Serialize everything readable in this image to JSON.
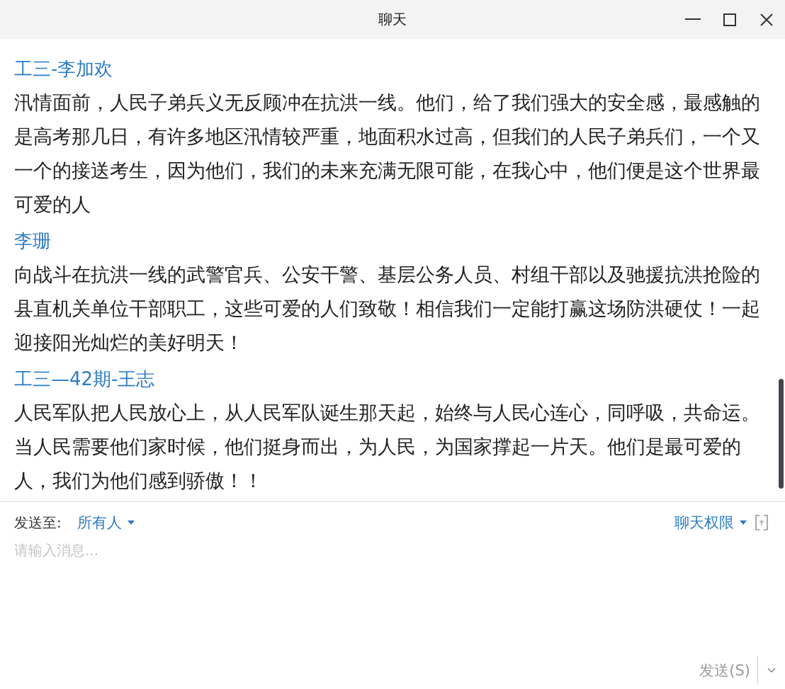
{
  "window": {
    "title": "聊天"
  },
  "messages": [
    {
      "sender": "工三-李加欢",
      "text": "汛情面前，人民子弟兵义无反顾冲在抗洪一线。他们，给了我们强大的安全感，最感触的是高考那几日，有许多地区汛情较严重，地面积水过高，但我们的人民子弟兵们，一个又一个的接送考生，因为他们，我们的未来充满无限可能，在我心中，他们便是这个世界最可爱的人"
    },
    {
      "sender": "李珊",
      "text": "向战斗在抗洪一线的武警官兵、公安干警、基层公务人员、村组干部以及驰援抗洪抢险的县直机关单位干部职工，这些可爱的人们致敬！相信我们一定能打赢这场防洪硬仗！一起迎接阳光灿烂的美好明天！"
    },
    {
      "sender": "工三—42期-王志",
      "text": "人民军队把人民放心上，从人民军队诞生那天起，始终与人民心连心，同呼吸，共命运。当人民需要他们家时候，他们挺身而出，为人民，为国家撑起一片天。他们是最可爱的人，我们为他们感到骄傲！！"
    }
  ],
  "composer": {
    "send_to_label": "发送至:",
    "recipient": "所有人",
    "permission": "聊天权限",
    "placeholder": "请输入消息...",
    "send_button": {
      "label": "发送(S)",
      "disabled": true
    }
  }
}
